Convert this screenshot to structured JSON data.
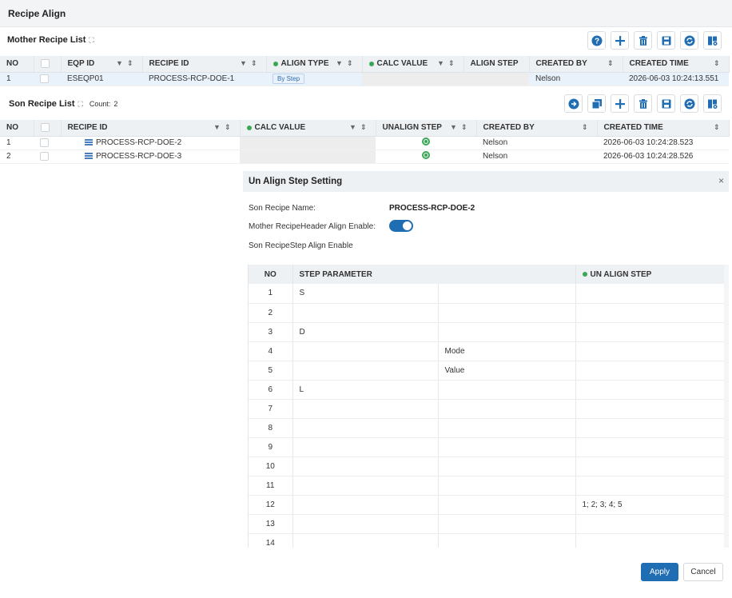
{
  "app": {
    "title": "Recipe Align"
  },
  "mother": {
    "title": "Mother Recipe List",
    "columns": [
      "NO",
      "EQP ID",
      "RECIPE ID",
      "ALIGN TYPE",
      "CALC VALUE",
      "ALIGN STEP",
      "CREATED BY",
      "CREATED TIME"
    ],
    "rows": [
      {
        "no": "1",
        "eqp_id": "ESEQP01",
        "recipe_id": "PROCESS-RCP-DOE-1",
        "align_type": "By Step",
        "calc_value": "",
        "align_step": "",
        "created_by": "Nelson",
        "created_time": "2026-06-03 10:24:13.551"
      }
    ]
  },
  "son": {
    "title": "Son Recipe List",
    "count_label": "Count:",
    "count": "2",
    "columns": [
      "NO",
      "RECIPE ID",
      "CALC VALUE",
      "UNALIGN STEP",
      "CREATED BY",
      "CREATED TIME"
    ],
    "rows": [
      {
        "no": "1",
        "recipe_id": "PROCESS-RCP-DOE-2",
        "created_by": "Nelson",
        "created_time": "2026-06-03 10:24:28.523"
      },
      {
        "no": "2",
        "recipe_id": "PROCESS-RCP-DOE-3",
        "created_by": "Nelson",
        "created_time": "2026-06-03 10:24:28.526"
      }
    ]
  },
  "dialog": {
    "title": "Un Align Step Setting",
    "close": "×",
    "son_name_label": "Son Recipe Name:",
    "son_name_value": "PROCESS-RCP-DOE-2",
    "header_align_label": "Mother RecipeHeader Align Enable:",
    "header_align_enabled": true,
    "step_align_label": "Son RecipeStep Align Enable",
    "columns": [
      "NO",
      "STEP PARAMETER",
      "UN ALIGN STEP"
    ],
    "rows": [
      {
        "no": "1",
        "param": "S",
        "sub": "",
        "unalign": ""
      },
      {
        "no": "2",
        "param": "",
        "sub": "",
        "unalign": ""
      },
      {
        "no": "3",
        "param": "D",
        "sub": "",
        "unalign": ""
      },
      {
        "no": "4",
        "param": "",
        "sub": "Mode",
        "unalign": ""
      },
      {
        "no": "5",
        "param": "",
        "sub": "Value",
        "unalign": ""
      },
      {
        "no": "6",
        "param": "L",
        "sub": "",
        "unalign": ""
      },
      {
        "no": "7",
        "param": "",
        "sub": "",
        "unalign": ""
      },
      {
        "no": "8",
        "param": "",
        "sub": "",
        "unalign": ""
      },
      {
        "no": "9",
        "param": "",
        "sub": "",
        "unalign": ""
      },
      {
        "no": "10",
        "param": "",
        "sub": "",
        "unalign": ""
      },
      {
        "no": "11",
        "param": "",
        "sub": "",
        "unalign": ""
      },
      {
        "no": "12",
        "param": "",
        "sub": "",
        "unalign": "1; 2; 3; 4; 5"
      },
      {
        "no": "13",
        "param": "",
        "sub": "",
        "unalign": ""
      },
      {
        "no": "14",
        "param": "",
        "sub": "",
        "unalign": ""
      }
    ],
    "apply_label": "Apply",
    "cancel_label": "Cancel"
  },
  "icons": {
    "mother_toolbar": [
      "help-icon",
      "add-icon",
      "delete-icon",
      "save-icon",
      "refresh-icon",
      "column-settings-icon"
    ],
    "son_toolbar": [
      "import-icon",
      "copy-icon",
      "add-icon",
      "delete-icon",
      "save-icon",
      "refresh-icon",
      "column-settings-icon"
    ]
  },
  "colors": {
    "primary": "#1f6db3",
    "status_green": "#3aa757",
    "header_bg": "#eef1f4"
  }
}
